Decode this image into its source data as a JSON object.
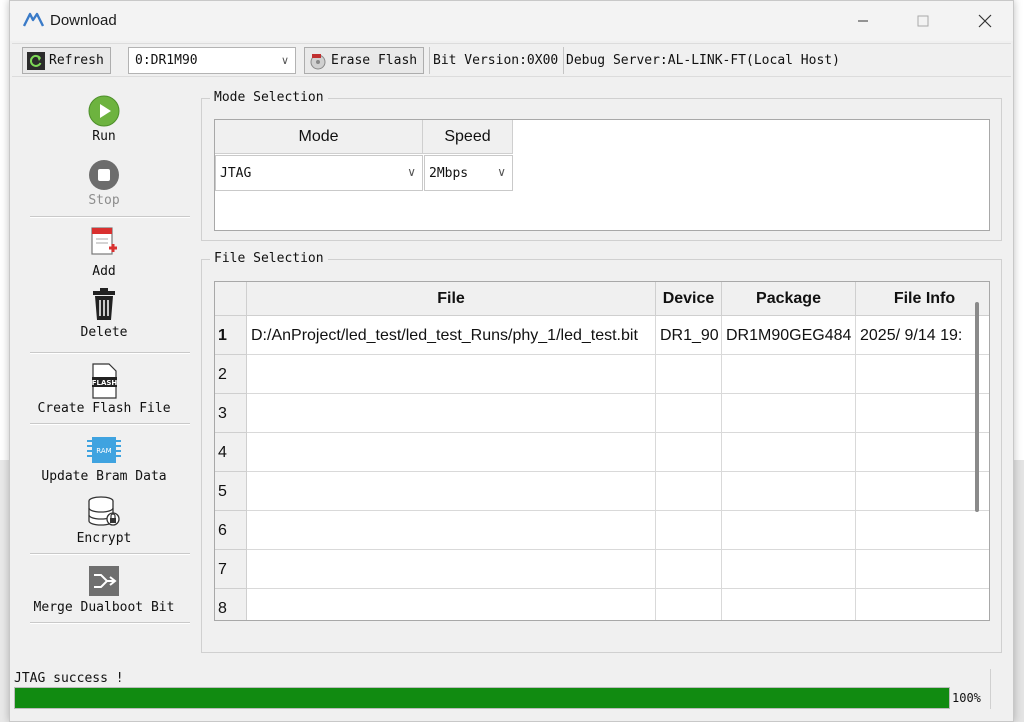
{
  "window": {
    "title": "Download"
  },
  "toolbar": {
    "refresh_label": "Refresh",
    "device_select_value": "0:DR1M90",
    "erase_flash_label": "Erase Flash",
    "bit_version": "Bit Version:0X00",
    "debug_server": "Debug Server:AL-LINK-FT(Local Host)"
  },
  "sidebar": {
    "run": "Run",
    "stop": "Stop",
    "add": "Add",
    "delete": "Delete",
    "create_flash": "Create Flash File",
    "update_bram": "Update Bram Data",
    "encrypt": "Encrypt",
    "merge": "Merge Dualboot Bit",
    "flash_icon_text": "FLASH",
    "ram_icon_text": "RAM"
  },
  "mode_selection": {
    "title": "Mode Selection",
    "headers": [
      "Mode",
      "Speed"
    ],
    "mode_value": "JTAG",
    "speed_value": "2Mbps"
  },
  "file_selection": {
    "title": "File Selection",
    "headers": [
      "File",
      "Device",
      "Package",
      "File Info"
    ],
    "rows": [
      {
        "num": "1",
        "file": "D:/AnProject/led_test/led_test_Runs/phy_1/led_test.bit",
        "device": "DR1_90",
        "package": "DR1M90GEG484",
        "info": "2025/ 9/14 19:"
      },
      {
        "num": "2",
        "file": "",
        "device": "",
        "package": "",
        "info": ""
      },
      {
        "num": "3",
        "file": "",
        "device": "",
        "package": "",
        "info": ""
      },
      {
        "num": "4",
        "file": "",
        "device": "",
        "package": "",
        "info": ""
      },
      {
        "num": "5",
        "file": "",
        "device": "",
        "package": "",
        "info": ""
      },
      {
        "num": "6",
        "file": "",
        "device": "",
        "package": "",
        "info": ""
      },
      {
        "num": "7",
        "file": "",
        "device": "",
        "package": "",
        "info": ""
      },
      {
        "num": "8",
        "file": "",
        "device": "",
        "package": "",
        "info": ""
      }
    ]
  },
  "status": {
    "message": "JTAG success !",
    "progress_label": "100%",
    "progress_value": 100
  },
  "colors": {
    "progress": "#118b11",
    "run_green": "#6db33f",
    "delete_red": "#d9302f"
  }
}
